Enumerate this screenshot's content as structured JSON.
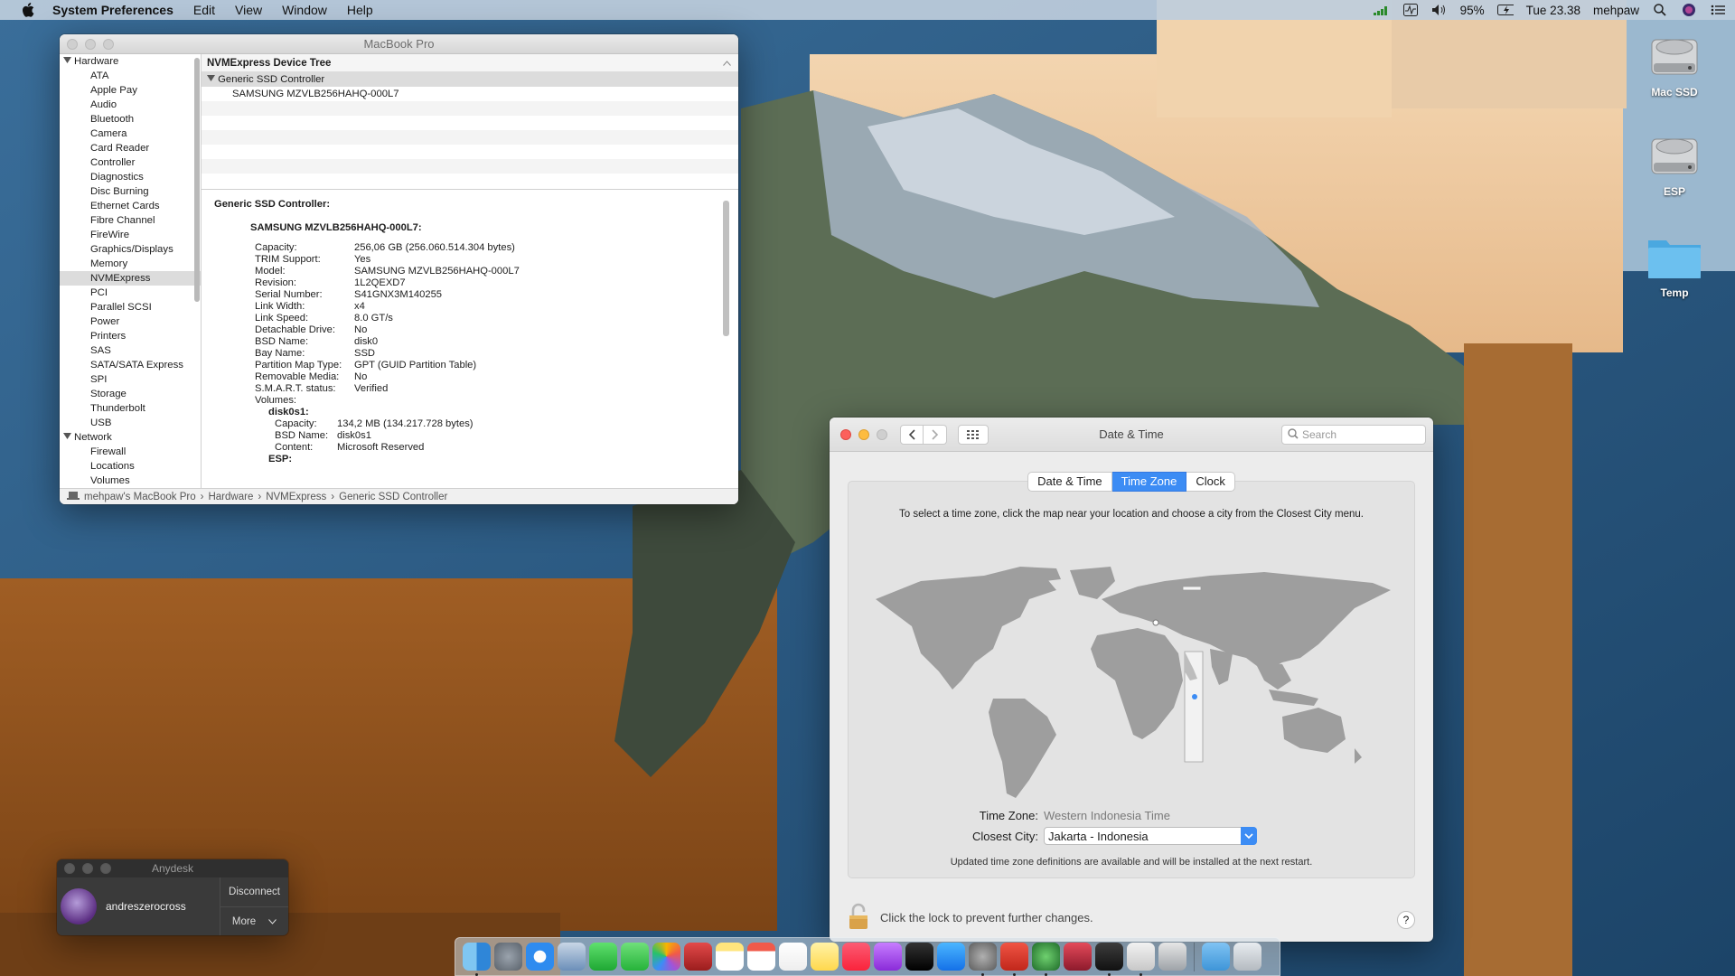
{
  "menubar": {
    "app_name": "System Preferences",
    "menus": [
      "Edit",
      "View",
      "Window",
      "Help"
    ],
    "battery": "95%",
    "clock": "Tue 23.38",
    "user": "mehpaw"
  },
  "desktop_icons": [
    {
      "label": "Mac SSD",
      "icon": "hard-drive-icon"
    },
    {
      "label": "ESP",
      "icon": "hard-drive-icon"
    },
    {
      "label": "Temp",
      "icon": "folder-icon"
    }
  ],
  "sysinfo": {
    "window_title": "MacBook Pro",
    "sidebar": {
      "hardware_label": "Hardware",
      "hardware_items": [
        "ATA",
        "Apple Pay",
        "Audio",
        "Bluetooth",
        "Camera",
        "Card Reader",
        "Controller",
        "Diagnostics",
        "Disc Burning",
        "Ethernet Cards",
        "Fibre Channel",
        "FireWire",
        "Graphics/Displays",
        "Memory",
        "NVMExpress",
        "PCI",
        "Parallel SCSI",
        "Power",
        "Printers",
        "SAS",
        "SATA/SATA Express",
        "SPI",
        "Storage",
        "Thunderbolt",
        "USB"
      ],
      "selected": "NVMExpress",
      "network_label": "Network",
      "network_items": [
        "Firewall",
        "Locations",
        "Volumes"
      ]
    },
    "tree": {
      "header": "NVMExpress Device Tree",
      "controller": "Generic SSD Controller",
      "device": "SAMSUNG MZVLB256HAHQ-000L7"
    },
    "details": {
      "title": "Generic SSD Controller:",
      "device_title": "SAMSUNG MZVLB256HAHQ-000L7:",
      "fields": [
        {
          "k": "Capacity:",
          "v": "256,06 GB (256.060.514.304 bytes)"
        },
        {
          "k": "TRIM Support:",
          "v": "Yes"
        },
        {
          "k": "Model:",
          "v": "SAMSUNG MZVLB256HAHQ-000L7"
        },
        {
          "k": "Revision:",
          "v": "1L2QEXD7"
        },
        {
          "k": "Serial Number:",
          "v": "S41GNX3M140255"
        },
        {
          "k": "Link Width:",
          "v": "x4"
        },
        {
          "k": "Link Speed:",
          "v": "8.0 GT/s"
        },
        {
          "k": "Detachable Drive:",
          "v": "No"
        },
        {
          "k": "BSD Name:",
          "v": "disk0"
        },
        {
          "k": "Bay Name:",
          "v": "SSD"
        },
        {
          "k": "Partition Map Type:",
          "v": "GPT (GUID Partition Table)"
        },
        {
          "k": "Removable Media:",
          "v": "No"
        },
        {
          "k": "S.M.A.R.T. status:",
          "v": "Verified"
        },
        {
          "k": "Volumes:",
          "v": ""
        }
      ],
      "volume1_name": "disk0s1:",
      "volume1_fields": [
        {
          "k": "Capacity:",
          "v": "134,2 MB (134.217.728 bytes)"
        },
        {
          "k": "BSD Name:",
          "v": "disk0s1"
        },
        {
          "k": "Content:",
          "v": "Microsoft Reserved"
        }
      ],
      "volume2_name": "ESP:"
    },
    "pathbar": [
      "mehpaw's MacBook Pro",
      "Hardware",
      "NVMExpress",
      "Generic SSD Controller"
    ]
  },
  "datetime": {
    "window_title": "Date & Time",
    "search_placeholder": "Search",
    "tabs": [
      "Date & Time",
      "Time Zone",
      "Clock"
    ],
    "active_tab": "Time Zone",
    "instructions": "To select a time zone, click the map near your location and choose a city from the Closest City menu.",
    "time_zone_label": "Time Zone:",
    "time_zone_value": "Western Indonesia Time",
    "closest_city_label": "Closest City:",
    "closest_city_value": "Jakarta - Indonesia",
    "update_note": "Updated time zone definitions are available and will be installed at the next restart.",
    "lock_text": "Click the lock to prevent further changes.",
    "help_label": "?"
  },
  "anydesk": {
    "title": "Anydesk",
    "user": "andreszerocross",
    "disconnect": "Disconnect",
    "more": "More"
  },
  "colors": {
    "accent": "#3c8cf4",
    "close_red": "#fc605c",
    "minimize_yellow": "#fdbc40"
  },
  "dock_icons": [
    "finder-icon",
    "launchpad-icon",
    "safari-icon",
    "preview-icon",
    "facetime-icon",
    "messages-icon",
    "photos-icon",
    "photo-booth-icon",
    "notes-icon",
    "calendar-icon",
    "reminders-icon",
    "stickies-icon",
    "music-icon",
    "podcasts-icon",
    "apple-tv-icon",
    "app-store-icon",
    "system-preferences-icon",
    "anydesk-icon",
    "network-radar-icon",
    "speedtest-icon",
    "terminal-icon",
    "script-editor-icon",
    "disk-utility-icon",
    "downloads-folder-icon",
    "trash-icon"
  ]
}
